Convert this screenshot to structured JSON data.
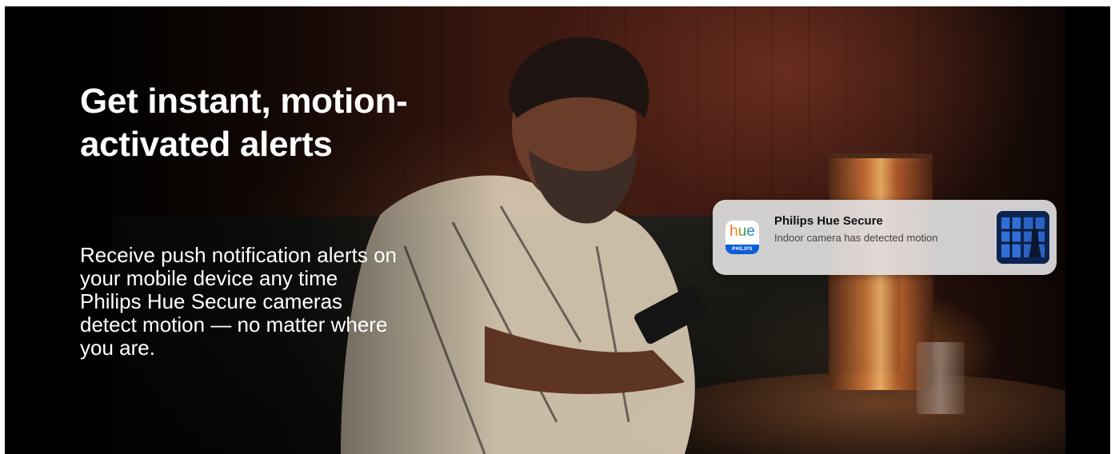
{
  "hero": {
    "headline": "Get instant, motion-activated alerts",
    "body": "Receive push notification alerts on your mobile device any time Philips Hue Secure cameras detect motion — no matter where you are."
  },
  "notification": {
    "app_icon": {
      "name": "hue-app-icon",
      "wordmark": "hue",
      "brand": "PHILIPS"
    },
    "title": "Philips Hue Secure",
    "message": "Indoor camera has detected motion",
    "thumbnail_icon": "camera-snapshot"
  },
  "colors": {
    "text": "#ffffff",
    "card_background": "#e1dee0",
    "philips_blue": "#0b5ed7"
  }
}
